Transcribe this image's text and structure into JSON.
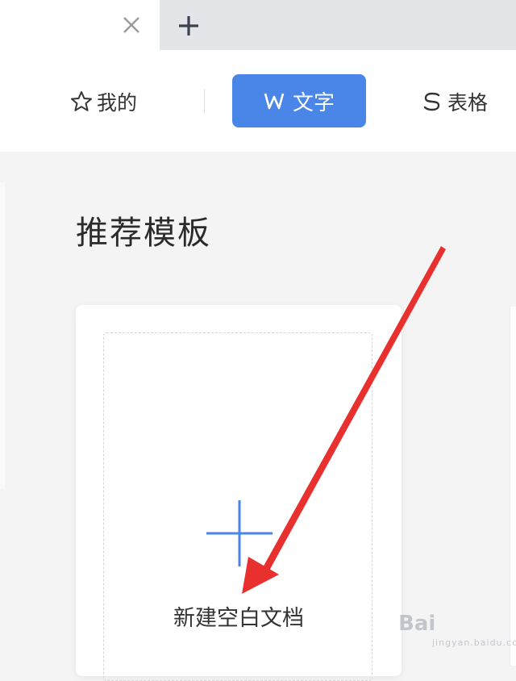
{
  "tabs": {
    "close_icon": "close-icon",
    "new_tab_icon": "plus-icon"
  },
  "categories": {
    "mine": {
      "label": "我的",
      "icon": "star-icon"
    },
    "writer": {
      "label": "文字",
      "icon": "W",
      "active": true
    },
    "sheet": {
      "label": "表格",
      "icon": "S"
    }
  },
  "main": {
    "section_title": "推荐模板",
    "new_blank_card": {
      "label": "新建空白文档",
      "icon": "plus-icon"
    }
  },
  "annotation": {
    "type": "red-arrow",
    "color": "#e8302e"
  },
  "watermark": {
    "text": "Bai",
    "sub": "jingyan.baidu.com"
  },
  "colors": {
    "accent": "#4a86e8",
    "tab_inactive": "#e4e5e9",
    "background": "#f4f4f5",
    "arrow": "#e8302e"
  }
}
